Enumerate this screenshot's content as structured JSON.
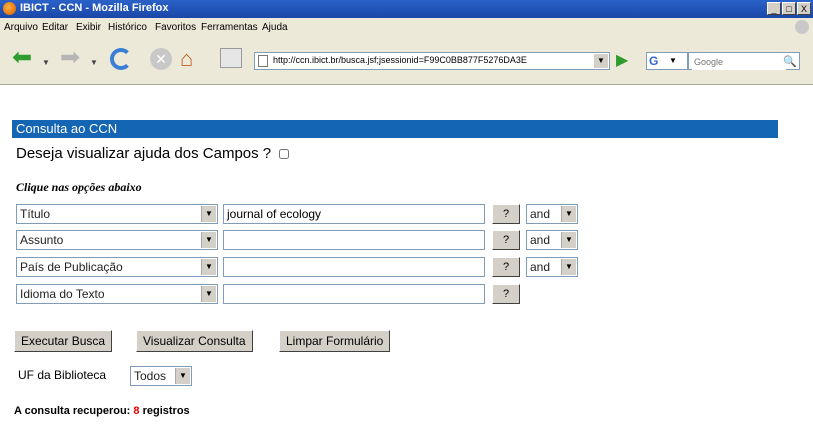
{
  "window": {
    "title": "IBICT - CCN - Mozilla Firefox",
    "controls": [
      "_",
      "□",
      "X"
    ]
  },
  "menu": [
    "Arquivo",
    "Editar",
    "Exibir",
    "Histórico",
    "Favoritos",
    "Ferramentas",
    "Ajuda"
  ],
  "nav": {
    "url": "http://ccn.ibict.br/busca.jsf;jsessionid=F99C0BB877F5276DA3E",
    "search_placeholder": "Google",
    "search_engine": "G"
  },
  "page": {
    "header": "Consulta ao CCN",
    "help_label": "Deseja visualizar ajuda dos Campos ?",
    "options_label": "Clique nas opções abaixo",
    "rows": [
      {
        "field": "Título",
        "value": "journal of ecology",
        "help": "?",
        "op": "and"
      },
      {
        "field": "Assunto",
        "value": "",
        "help": "?",
        "op": "and"
      },
      {
        "field": "País de Publicação",
        "value": "",
        "help": "?",
        "op": "and"
      },
      {
        "field": "Idioma do Texto",
        "value": "",
        "help": "?"
      }
    ],
    "buttons": {
      "execute": "Executar Busca",
      "view": "Visualizar Consulta",
      "clear": "Limpar Formulário"
    },
    "uf_label": "UF da Biblioteca",
    "uf_value": "Todos",
    "result_prefix": "A consulta recuperou:",
    "result_count": "8",
    "result_suffix": "registros"
  }
}
